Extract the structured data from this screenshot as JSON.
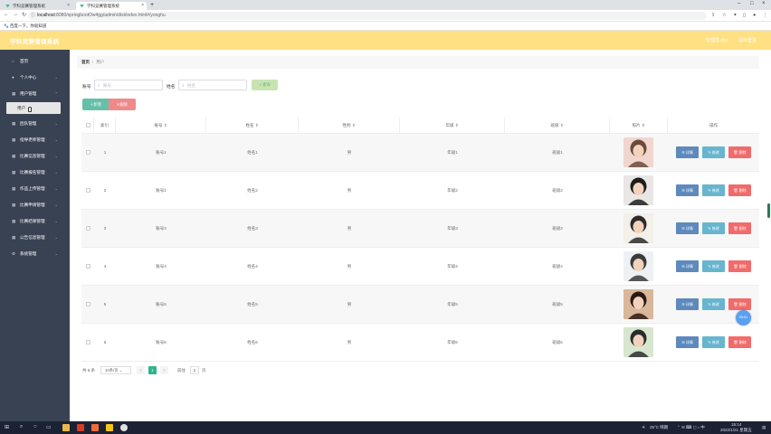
{
  "browser": {
    "tabs": [
      {
        "label": "学科竞赛管理系统",
        "active": false
      },
      {
        "label": "学科竞赛管理系统",
        "active": true
      }
    ],
    "url_host": "localhost",
    "url_path": ":8080/springbootOw4gg/admin/dist/index.html#/yonghu",
    "bookmark": "百度一下，你就知道"
  },
  "app": {
    "title": "学科竞赛管理系统",
    "user": "管理员 abo",
    "logout": "退出登录"
  },
  "sidebar": {
    "items": [
      {
        "label": "首页",
        "icon": "home-icon"
      },
      {
        "label": "个人中心",
        "icon": "user-icon"
      },
      {
        "label": "用户管理",
        "icon": "grid-icon"
      },
      {
        "label": "团队管理",
        "icon": "grid-icon"
      },
      {
        "label": "指导老师管理",
        "icon": "grid-icon"
      },
      {
        "label": "比赛信息管理",
        "icon": "grid-icon"
      },
      {
        "label": "比赛报名管理",
        "icon": "grid-icon"
      },
      {
        "label": "作品上传管理",
        "icon": "grid-icon"
      },
      {
        "label": "比赛申请管理",
        "icon": "grid-icon"
      },
      {
        "label": "比赛结果管理",
        "icon": "grid-icon"
      },
      {
        "label": "公告信息管理",
        "icon": "grid-icon"
      },
      {
        "label": "系统管理",
        "icon": "gear-icon"
      }
    ],
    "active_sub": "用户"
  },
  "breadcrumb": {
    "home": "首页",
    "sep": "/",
    "current": "用户"
  },
  "search": {
    "account_label": "账号",
    "account_placeholder": "账号",
    "name_label": "姓名",
    "name_placeholder": "姓名",
    "query_button": "查询"
  },
  "actions": {
    "add": "新增",
    "delete": "删除"
  },
  "table": {
    "headers": [
      "索引",
      "账号",
      "姓名",
      "性别",
      "年级",
      "班级",
      "照片",
      "操作"
    ],
    "rows": [
      {
        "index": "1",
        "account": "账号1",
        "name": "姓名1",
        "gender": "男",
        "grade": "年级1",
        "class": "班级1"
      },
      {
        "index": "2",
        "account": "账号2",
        "name": "姓名2",
        "gender": "男",
        "grade": "年级2",
        "class": "班级2"
      },
      {
        "index": "3",
        "account": "账号3",
        "name": "姓名3",
        "gender": "男",
        "grade": "年级3",
        "class": "班级3"
      },
      {
        "index": "4",
        "account": "账号4",
        "name": "姓名4",
        "gender": "男",
        "grade": "年级4",
        "class": "班级4"
      },
      {
        "index": "5",
        "account": "账号5",
        "name": "姓名5",
        "gender": "男",
        "grade": "年级5",
        "class": "班级5"
      },
      {
        "index": "6",
        "account": "账号6",
        "name": "姓名6",
        "gender": "男",
        "grade": "年级6",
        "class": "班级6"
      }
    ],
    "row_actions": {
      "detail": "详情",
      "edit": "修改",
      "delete": "删除"
    }
  },
  "pagination": {
    "total": "共 6 条",
    "page_size": "10条/页",
    "prev": "<",
    "current": "1",
    "next": ">",
    "goto_label": "前往",
    "goto_value": "1",
    "goto_suffix": "页"
  },
  "float_badge": "00:01",
  "taskbar": {
    "weather": "25°C 晴朗",
    "time": "15:14",
    "date": "2022/1/21 星期五"
  },
  "colors": {
    "header": "#ffe082",
    "sidebar": "#394253",
    "accent": "#2fb38d",
    "danger": "#f26b6b"
  }
}
